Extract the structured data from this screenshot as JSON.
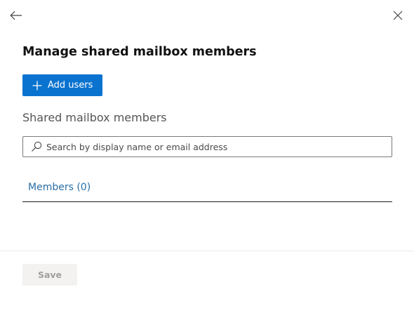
{
  "header": {
    "back_icon": "arrow-left-icon",
    "close_icon": "close-icon"
  },
  "page": {
    "title": "Manage shared mailbox members"
  },
  "toolbar": {
    "add_users_label": "Add users",
    "add_icon": "plus-icon",
    "accent_color": "#0a73cf"
  },
  "members_section": {
    "title": "Shared mailbox members",
    "search": {
      "placeholder": "Search by display name or email address",
      "value": "",
      "icon": "search-icon"
    },
    "tabs": [
      {
        "label": "Members (0)",
        "selected": true
      }
    ],
    "tab_color": "#2a6fa6"
  },
  "footer": {
    "save_label": "Save",
    "save_disabled": true
  }
}
